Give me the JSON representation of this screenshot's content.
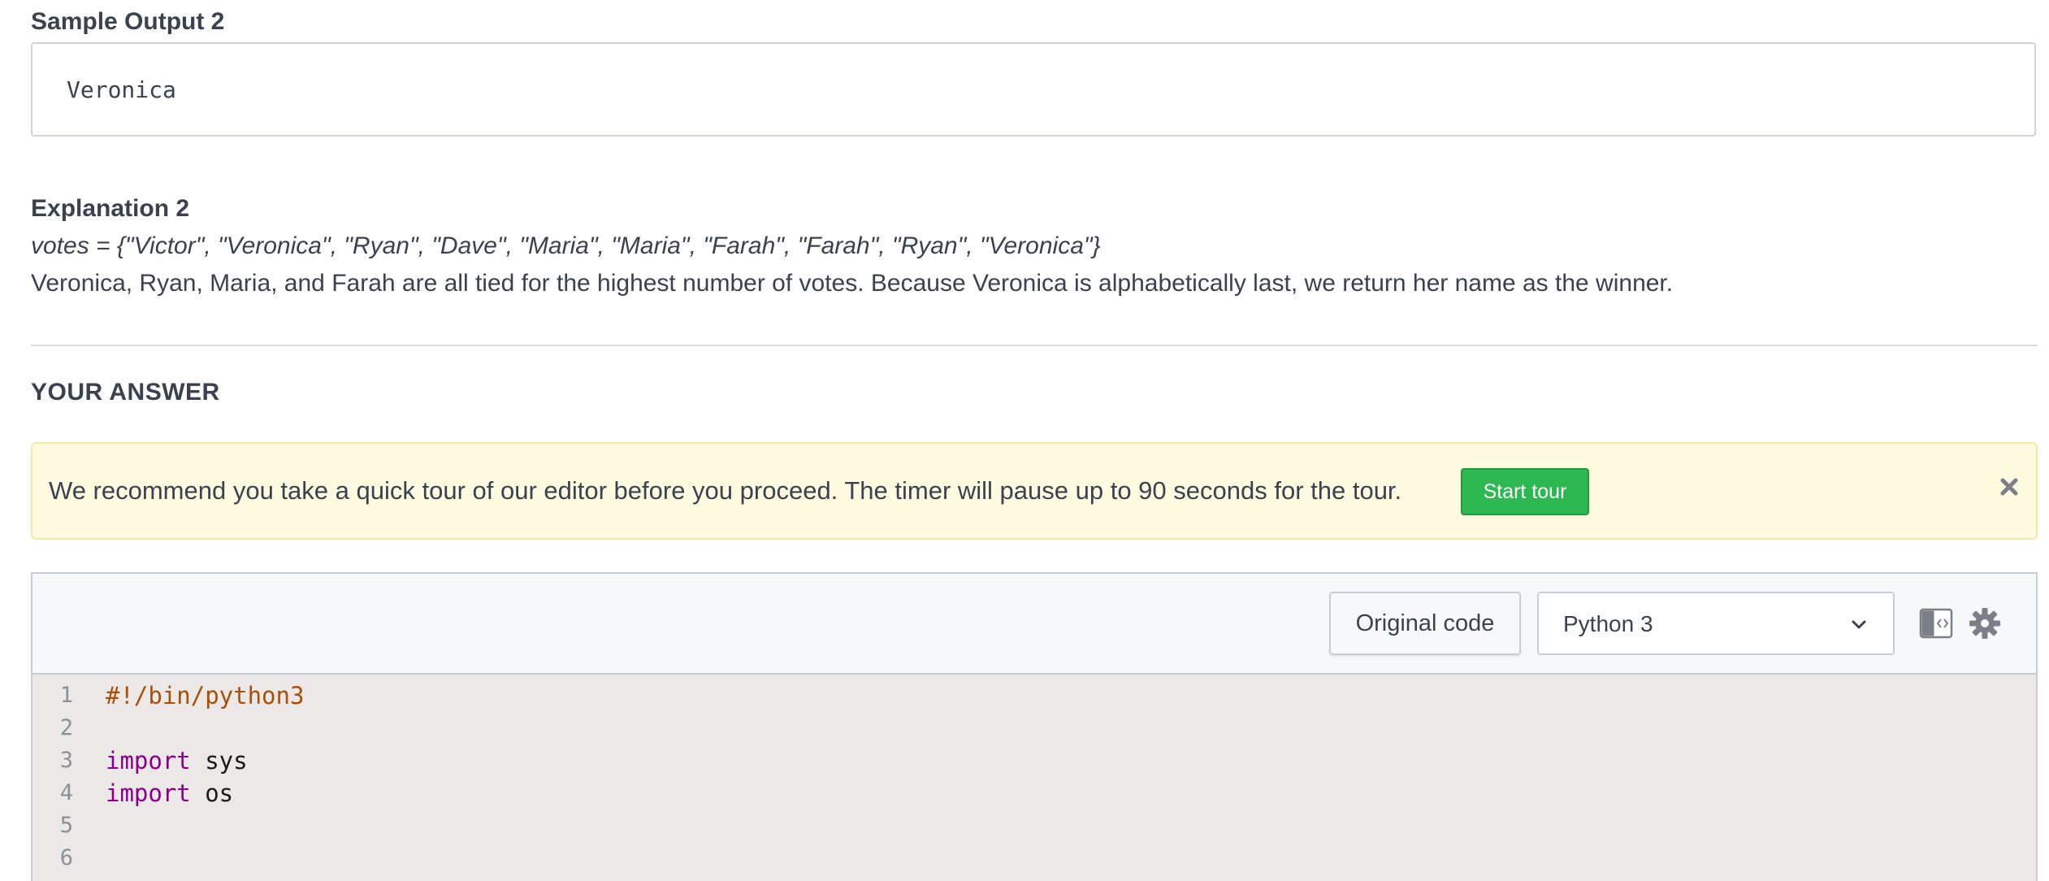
{
  "sample_output": {
    "title": "Sample Output 2",
    "value": "Veronica"
  },
  "explanation": {
    "title": "Explanation 2",
    "votes_line": "votes = {\"Victor\", \"Veronica\", \"Ryan\", \"Dave\", \"Maria\", \"Maria\", \"Farah\", \"Farah\", \"Ryan\", \"Veronica\"}",
    "text": "Veronica, Ryan, Maria, and Farah are all tied for the highest number of votes. Because Veronica is alphabetically last, we return her name as the winner."
  },
  "answer": {
    "title": "YOUR ANSWER"
  },
  "tour_banner": {
    "message": "We recommend you take a quick tour of our editor before you proceed. The timer will pause up to 90 seconds for the tour.",
    "button_label": "Start tour",
    "close_icon": "close-icon",
    "background_color": "#fffbe0",
    "button_color": "#2eb852"
  },
  "editor": {
    "original_code_label": "Original code",
    "language": "Python 3",
    "icons": [
      "layout-toggle-icon",
      "gear-icon",
      "chevron-down-icon"
    ],
    "background_color": "#ece8e7",
    "lines": [
      {
        "num": "1",
        "keyword": "",
        "rest": "#!/bin/python3",
        "is_comment": true
      },
      {
        "num": "2",
        "keyword": "",
        "rest": "",
        "is_comment": false
      },
      {
        "num": "3",
        "keyword": "import",
        "rest": " sys",
        "is_comment": false
      },
      {
        "num": "4",
        "keyword": "import",
        "rest": " os",
        "is_comment": false
      },
      {
        "num": "5",
        "keyword": "",
        "rest": "",
        "is_comment": false
      },
      {
        "num": "6",
        "keyword": "",
        "rest": "",
        "is_comment": false
      }
    ]
  }
}
